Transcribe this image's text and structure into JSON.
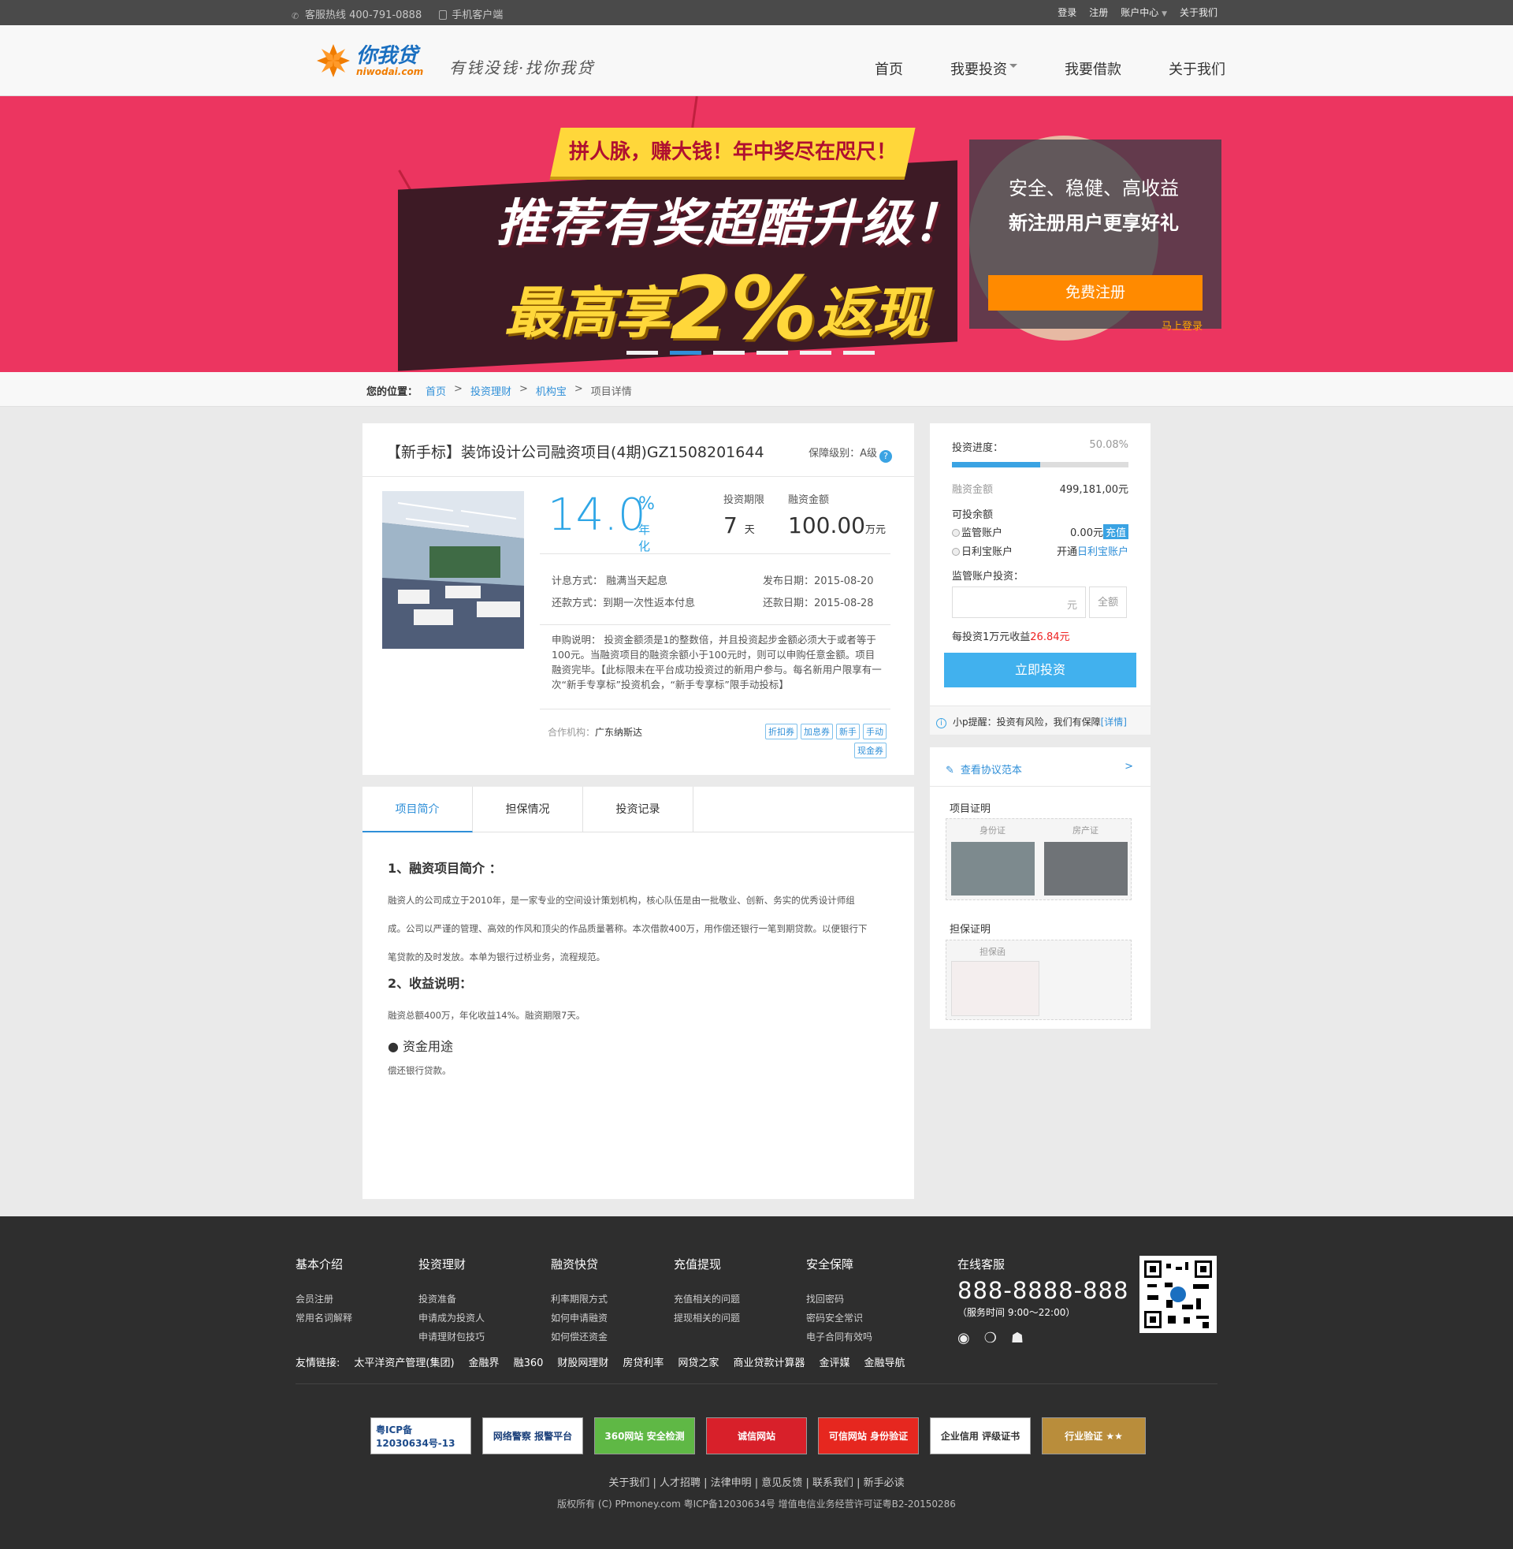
{
  "topbar": {
    "hotline": "客服热线 400-791-0888",
    "mobile": "手机客户端",
    "login": "登录",
    "register": "注册",
    "account": "账户中心",
    "about": "关于我们"
  },
  "header": {
    "logo_cn": "你我贷",
    "logo_en": "niwodai.com",
    "slogan": "有钱没钱·找你我贷",
    "nav": [
      "首页",
      "我要投资",
      "我要借款",
      "关于我们"
    ]
  },
  "banner": {
    "ribbon": "拼人脉，赚大钱！年中奖尽在咫尺！",
    "headline": "推荐有奖超酷升级！",
    "sub_prefix": "最高享",
    "sub_big": "2%",
    "sub_suffix": "返现",
    "slides": 6,
    "active_slide": 2,
    "reg_line1": "安全、稳健、高收益",
    "reg_line2": "新注册用户更享好礼",
    "reg_button": "免费注册",
    "reg_login": "马上登录"
  },
  "breadcrumb": {
    "label": "您的位置：",
    "items": [
      "首页",
      "投资理财",
      "机构宝",
      "项目详情"
    ],
    "sep": ">"
  },
  "project": {
    "title": "【新手标】装饰设计公司融资项目(4期)GZ1508201644",
    "level": "保障级别：A级",
    "rate": "14.0",
    "rate_unit": "%",
    "rate_label": "年化",
    "term_label": "投资期限",
    "term_value": "7",
    "term_unit": "天",
    "amount_label": "融资金额",
    "amount_value": "100.00",
    "amount_unit": "万元",
    "interest_method": "计息方式：  融满当天起息",
    "publish_date": "发布日期：2015-08-20",
    "repay_method": "还款方式：到期一次性返本付息",
    "repay_date": "还款日期：2015-08-28",
    "description": "申购说明： 投资金额须是1的整数倍，并且投资起步金额必须大于或者等于100元。当融资项目的融资余额小于100元时，则可以申购任意金额。项目融资完毕。【此标限未在平台成功投资过的新用户参与。每名新用户限享有一次“新手专享标”投资机会，“新手专享标”限手动投标】",
    "partner_label": "合作机构：",
    "partner": "广东纳斯达",
    "tags": [
      "折扣券",
      "加息券",
      "新手",
      "手动",
      "现金券"
    ]
  },
  "invest": {
    "progress_label": "投资进度：",
    "progress_pct": "50.08%",
    "progress": 0.5008,
    "raised_label": "融资金额",
    "raised_value": "499,181,00元",
    "available_label": "可投余额",
    "account1": "监管账户",
    "account1_value": "0.00元",
    "recharge": "充值",
    "account2": "日利宝账户",
    "account2_prefix": "开通",
    "account2_link": "日利宝账户",
    "invest_label": "监管账户投资：",
    "input_unit": "元",
    "all_button": "全额",
    "earn_prefix": "每投资1万元收益",
    "earn_value": "26.84元",
    "invest_button": "立即投资",
    "tip": "小p提醒：投资有风险，我们有保障",
    "tip_link": "[详情]"
  },
  "docs": {
    "agreement": "查看协议范本",
    "arrow": ">",
    "project_proof": "项目证明",
    "id_card": "身份证",
    "house_cert": "房产证",
    "guarantee_proof": "担保证明",
    "guarantee_letter": "担保函"
  },
  "tabs": [
    "项目简介",
    "担保情况",
    "投资记录"
  ],
  "article": {
    "h1": "1、融资项目简介 ：",
    "p1a": "融资人的公司成立于2010年，是一家专业的空间设计策划机构，核心队伍是由一批敬业、创新、务实的优秀设计师组",
    "p1b": "成。公司以严谨的管理、高效的作风和顶尖的作品质量著称。本次借款400万，用作偿还银行一笔到期贷款。以便银行下",
    "p1c": "笔贷款的及时发放。本单为银行过桥业务，流程规范。",
    "h2": "2、收益说明：",
    "p2": "融资总额400万，年化收益14%。融资期限7天。",
    "h3": "● 资金用途",
    "p3": "偿还银行贷款。"
  },
  "footer": {
    "cols": [
      {
        "title": "基本介绍",
        "items": [
          "会员注册",
          "常用名词解释"
        ]
      },
      {
        "title": "投资理财",
        "items": [
          "投资准备",
          "申请成为投资人",
          "申请理财包技巧"
        ]
      },
      {
        "title": "融资快贷",
        "items": [
          "利率期限方式",
          "如何申请融资",
          "如何偿还资金"
        ]
      },
      {
        "title": "充值提现",
        "items": [
          "充值相关的问题",
          "提现相关的问题"
        ]
      },
      {
        "title": "安全保障",
        "items": [
          "找回密码",
          "密码安全常识",
          "电子合同有效吗"
        ]
      }
    ],
    "service_title": "在线客服",
    "service_tel": "888-8888-888",
    "service_hours": "（服务时间 9:00～22:00）",
    "links_label": "友情链接:",
    "links": [
      "太平洋资产管理(集团)",
      "金融界",
      "融360",
      "财股网理财",
      "房贷利率",
      "网贷之家",
      "商业贷款计算器",
      "金评媒",
      "金融导航"
    ],
    "badges": [
      "粤ICP备 12030634号-13",
      "网络警察 报警平台",
      "360网站 安全检测",
      "诚信网站",
      "可信网站 身份验证",
      "企业信用 评级证书",
      "行业验证 ★★"
    ],
    "nav": "关于我们 | 人才招聘 | 法律申明 | 意见反馈 | 联系我们 | 新手必读",
    "copyright": "版权所有 (C) PPmoney.com  粤ICP备12030634号  增值电信业务经营许可证粤B2-20150286"
  }
}
